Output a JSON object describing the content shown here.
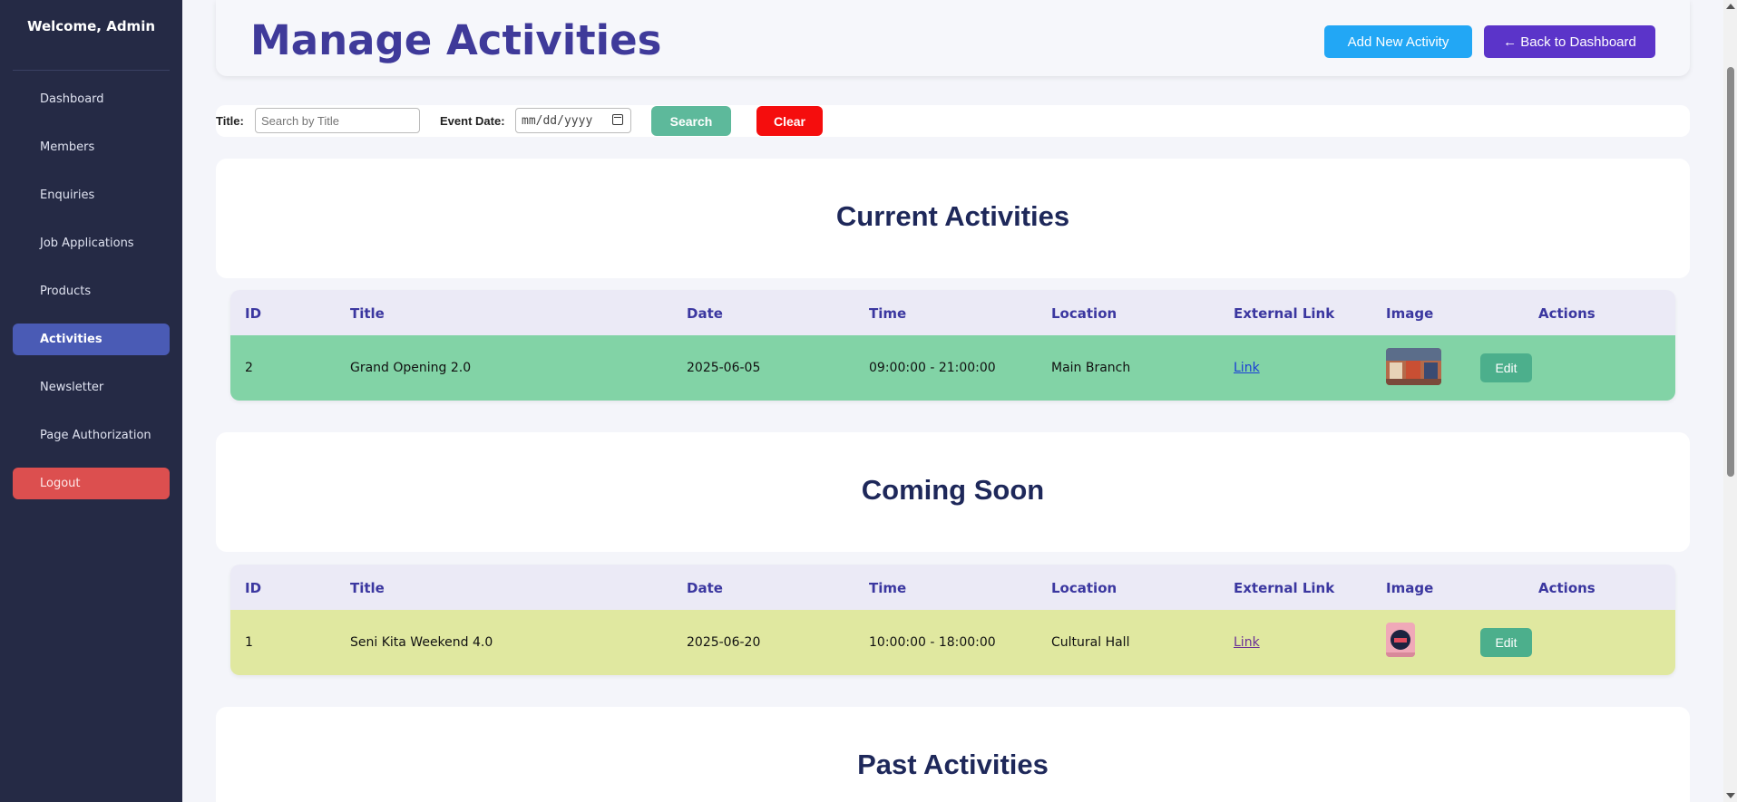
{
  "sidebar": {
    "welcome": "Welcome, Admin",
    "items": [
      {
        "label": "Dashboard"
      },
      {
        "label": "Members"
      },
      {
        "label": "Enquiries"
      },
      {
        "label": "Job Applications"
      },
      {
        "label": "Products"
      },
      {
        "label": "Activities"
      },
      {
        "label": "Newsletter"
      },
      {
        "label": "Page Authorization"
      },
      {
        "label": "Logout"
      }
    ]
  },
  "header": {
    "title": "Manage Activities",
    "add_label": "Add New Activity",
    "back_label": "← Back to Dashboard"
  },
  "filter": {
    "title_label": "Title:",
    "title_placeholder": "Search by Title",
    "date_label": "Event Date:",
    "date_value": "mm/dd/yyyy",
    "search_label": "Search",
    "clear_label": "Clear"
  },
  "columns": [
    "ID",
    "Title",
    "Date",
    "Time",
    "Location",
    "External Link",
    "Image",
    "Actions"
  ],
  "sections": {
    "current": {
      "title": "Current Activities",
      "row": {
        "id": "2",
        "title": "Grand Opening 2.0",
        "date": "2025-06-05",
        "time": "09:00:00 - 21:00:00",
        "location": "Main Branch",
        "link": "Link",
        "action": "Edit"
      }
    },
    "coming": {
      "title": "Coming Soon",
      "row": {
        "id": "1",
        "title": "Seni Kita Weekend 4.0",
        "date": "2025-06-20",
        "time": "10:00:00 - 18:00:00",
        "location": "Cultural Hall",
        "link": "Link",
        "action": "Edit"
      }
    },
    "past": {
      "title": "Past Activities"
    }
  },
  "colors": {
    "sidebar_bg": "#252a45",
    "active_nav": "#4a5bb5",
    "logout": "#dc4f4f",
    "current_row": "#82d3a6",
    "coming_row": "#e0e8a0",
    "accent_title": "#3f3a9a"
  }
}
